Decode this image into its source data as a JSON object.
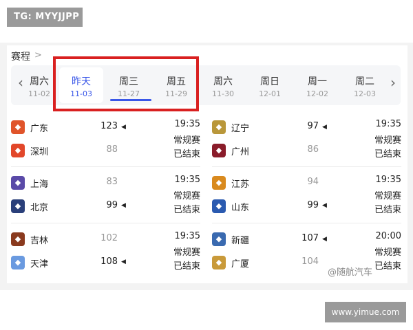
{
  "overlay_badge": "TG: MYYJJPP",
  "schedule": {
    "title": "赛程",
    "dates": [
      {
        "day": "周六",
        "date": "11-02"
      },
      {
        "day": "昨天",
        "date": "11-03",
        "selected": true
      },
      {
        "day": "周三",
        "date": "11-27"
      },
      {
        "day": "周五",
        "date": "11-29"
      },
      {
        "day": "周六",
        "date": "11-30"
      },
      {
        "day": "周日",
        "date": "12-01"
      },
      {
        "day": "周一",
        "date": "12-02"
      },
      {
        "day": "周二",
        "date": "12-03"
      }
    ],
    "prev_icon": "chevron-left-icon",
    "next_icon": "chevron-right-icon"
  },
  "games": [
    {
      "home": {
        "name": "广东",
        "score": "123",
        "win": true,
        "logo_color": "#e0542a"
      },
      "away": {
        "name": "深圳",
        "score": "88",
        "win": false,
        "logo_color": "#e2472a"
      },
      "time": "19:35",
      "type": "常规赛",
      "status": "已结束"
    },
    {
      "home": {
        "name": "辽宁",
        "score": "97",
        "win": true,
        "logo_color": "#b9973a"
      },
      "away": {
        "name": "广州",
        "score": "86",
        "win": false,
        "logo_color": "#8a1c2a"
      },
      "time": "19:35",
      "type": "常规赛",
      "status": "已结束"
    },
    {
      "home": {
        "name": "上海",
        "score": "83",
        "win": false,
        "logo_color": "#5a4aa8"
      },
      "away": {
        "name": "北京",
        "score": "99",
        "win": true,
        "logo_color": "#2a3f7a"
      },
      "time": "19:35",
      "type": "常规赛",
      "status": "已结束"
    },
    {
      "home": {
        "name": "江苏",
        "score": "94",
        "win": false,
        "logo_color": "#d98a1e"
      },
      "away": {
        "name": "山东",
        "score": "99",
        "win": true,
        "logo_color": "#2a5ab0"
      },
      "time": "19:35",
      "type": "常规赛",
      "status": "已结束"
    },
    {
      "home": {
        "name": "吉林",
        "score": "102",
        "win": false,
        "logo_color": "#8a3a1e"
      },
      "away": {
        "name": "天津",
        "score": "108",
        "win": true,
        "logo_color": "#6a9ae0"
      },
      "time": "19:35",
      "type": "常规赛",
      "status": "已结束"
    },
    {
      "home": {
        "name": "新疆",
        "score": "107",
        "win": true,
        "logo_color": "#3a6ab0"
      },
      "away": {
        "name": "广厦",
        "score": "104",
        "win": false,
        "logo_color": "#c99a3a"
      },
      "time": "20:00",
      "type": "常规赛",
      "status": "已结束"
    }
  ],
  "watermark": {
    "author": "@随航汽车",
    "site": "www.yimue.com"
  }
}
